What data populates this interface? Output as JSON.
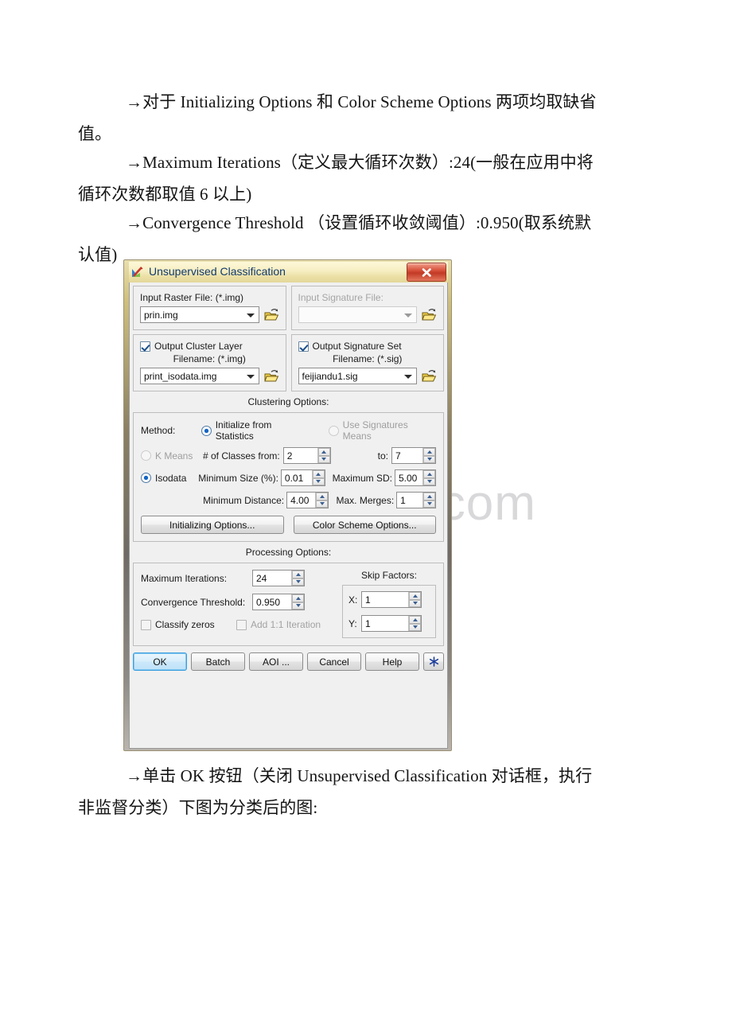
{
  "document": {
    "paragraphs": [
      {
        "lead": "→对于 Initializing Options 和 Color Scheme Options 两项均取缺省",
        "cont": "值。"
      },
      {
        "lead": "→Maximum Iterations（定义最大循环次数）:24(一般在应用中将",
        "cont": "循环次数都取值 6 以上)"
      },
      {
        "lead": "→Convergence Threshold （设置循环收敛阈值）:0.950(取系统默",
        "cont": "认值)"
      },
      {
        "lead": "→单击 OK 按钮（关闭 Unsupervised Classification 对话框，执行",
        "cont": "非监督分类）下图为分类后的图:"
      }
    ]
  },
  "watermark": {
    "text": "www.bdocx.com",
    "color": "#d8d8da"
  },
  "dialog": {
    "title": "Unsupervised Classification",
    "title_icon": "erdas-imagine-icon",
    "title_ghost": "",
    "close_icon": "close-x-icon",
    "accent_title_color": "#123a6e",
    "input_raster": {
      "label": "Input Raster File: (*.img)",
      "value": "prin.img",
      "browse_icon": "open-folder-icon"
    },
    "input_signature": {
      "label": "Input Signature File:",
      "value": "",
      "browse_icon": "open-folder-icon",
      "disabled": true
    },
    "output_cluster": {
      "checkbox_label": "Output Cluster Layer",
      "checked": true,
      "filename_label": "Filename: (*.img)",
      "value": "print_isodata.img",
      "browse_icon": "open-folder-icon"
    },
    "output_signature": {
      "checkbox_label": "Output Signature Set",
      "checked": true,
      "filename_label": "Filename: (*.sig)",
      "value": "feijiandu1.sig",
      "browse_icon": "open-folder-icon"
    },
    "clustering": {
      "section_title": "Clustering Options:",
      "method_label": "Method:",
      "init_from_statistics": "Initialize from Statistics",
      "init_from_statistics_selected": true,
      "use_signatures_means": "Use Signatures Means",
      "use_signatures_means_selected": false,
      "k_means": "K Means",
      "k_means_selected": false,
      "isodata": "Isodata",
      "isodata_selected": true,
      "classes_from_label": "# of Classes from:",
      "classes_from_value": "2",
      "classes_to_label": "to:",
      "classes_to_value": "7",
      "minimum_size_label": "Minimum Size (%):",
      "minimum_size_value": "0.01",
      "maximum_sd_label": "Maximum SD:",
      "maximum_sd_value": "5.00",
      "minimum_distance_label": "Minimum Distance:",
      "minimum_distance_value": "4.00",
      "max_merges_label": "Max. Merges:",
      "max_merges_value": "1",
      "initializing_options_button": "Initializing Options...",
      "color_scheme_options_button": "Color Scheme Options..."
    },
    "processing": {
      "section_title": "Processing Options:",
      "maximum_iterations_label": "Maximum Iterations:",
      "maximum_iterations_value": "24",
      "convergence_threshold_label": "Convergence Threshold:",
      "convergence_threshold_value": "0.950",
      "classify_zeros_label": "Classify zeros",
      "classify_zeros_checked": false,
      "add_iteration_label": "Add 1:1 Iteration",
      "add_iteration_checked": false,
      "add_iteration_disabled": true,
      "skip_factors_label": "Skip Factors:",
      "skip_x_label": "X:",
      "skip_x_value": "1",
      "skip_y_label": "Y:",
      "skip_y_value": "1"
    },
    "buttons": {
      "ok": "OK",
      "batch": "Batch",
      "aoi": "AOI ...",
      "cancel": "Cancel",
      "help": "Help",
      "extra_icon": "asterisk-icon"
    }
  }
}
